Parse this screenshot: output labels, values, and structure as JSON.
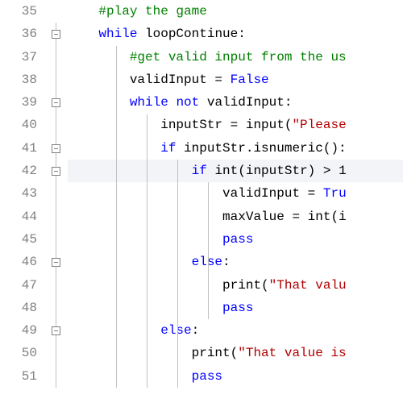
{
  "lines": [
    {
      "n": 35,
      "fold": false,
      "text": "    #play the game",
      "guides": [],
      "cls": "c-comment"
    },
    {
      "n": 36,
      "fold": true,
      "tokens": [
        [
          "    ",
          "c-plain"
        ],
        [
          "while",
          "c-kw"
        ],
        [
          " loopContinue:",
          "c-plain"
        ]
      ],
      "guides": []
    },
    {
      "n": 37,
      "fold": false,
      "tokens": [
        [
          "        ",
          "c-plain"
        ],
        [
          "#get valid input from the us",
          "c-comment"
        ]
      ],
      "guides": [
        1
      ]
    },
    {
      "n": 38,
      "fold": false,
      "tokens": [
        [
          "        validInput = ",
          "c-plain"
        ],
        [
          "False",
          "c-const"
        ]
      ],
      "guides": [
        1
      ]
    },
    {
      "n": 39,
      "fold": true,
      "tokens": [
        [
          "        ",
          "c-plain"
        ],
        [
          "while",
          "c-kw"
        ],
        [
          " ",
          "c-plain"
        ],
        [
          "not",
          "c-kw"
        ],
        [
          " validInput:",
          "c-plain"
        ]
      ],
      "guides": [
        1
      ]
    },
    {
      "n": 40,
      "fold": false,
      "tokens": [
        [
          "            inputStr = input(",
          "c-plain"
        ],
        [
          "\"Please",
          "c-str"
        ]
      ],
      "guides": [
        1,
        2
      ]
    },
    {
      "n": 41,
      "fold": true,
      "tokens": [
        [
          "            ",
          "c-plain"
        ],
        [
          "if",
          "c-kw"
        ],
        [
          " inputStr.isnumeric():",
          "c-plain"
        ]
      ],
      "guides": [
        1,
        2
      ]
    },
    {
      "n": 42,
      "fold": true,
      "hl": true,
      "tokens": [
        [
          "                ",
          "c-plain"
        ],
        [
          "if",
          "c-kw"
        ],
        [
          " ",
          "c-plain"
        ],
        [
          "int",
          "c-func"
        ],
        [
          "(inputStr) > 1",
          "c-plain"
        ]
      ],
      "guides": [
        1,
        2,
        3
      ]
    },
    {
      "n": 43,
      "fold": false,
      "tokens": [
        [
          "                    validInput = ",
          "c-plain"
        ],
        [
          "Tru",
          "c-const"
        ]
      ],
      "guides": [
        1,
        2,
        3,
        4
      ]
    },
    {
      "n": 44,
      "fold": false,
      "tokens": [
        [
          "                    maxValue = ",
          "c-plain"
        ],
        [
          "int",
          "c-func"
        ],
        [
          "(i",
          "c-plain"
        ]
      ],
      "guides": [
        1,
        2,
        3,
        4
      ]
    },
    {
      "n": 45,
      "fold": false,
      "tokens": [
        [
          "                    ",
          "c-plain"
        ],
        [
          "pass",
          "c-kw"
        ]
      ],
      "guides": [
        1,
        2,
        3,
        4
      ]
    },
    {
      "n": 46,
      "fold": true,
      "tokens": [
        [
          "                ",
          "c-plain"
        ],
        [
          "else",
          "c-kw"
        ],
        [
          ":",
          "c-plain"
        ]
      ],
      "guides": [
        1,
        2,
        3
      ]
    },
    {
      "n": 47,
      "fold": false,
      "tokens": [
        [
          "                    print(",
          "c-plain"
        ],
        [
          "\"That valu",
          "c-str"
        ]
      ],
      "guides": [
        1,
        2,
        3,
        4
      ]
    },
    {
      "n": 48,
      "fold": false,
      "tokens": [
        [
          "                    ",
          "c-plain"
        ],
        [
          "pass",
          "c-kw"
        ]
      ],
      "guides": [
        1,
        2,
        3,
        4
      ]
    },
    {
      "n": 49,
      "fold": true,
      "tokens": [
        [
          "            ",
          "c-plain"
        ],
        [
          "else",
          "c-kw"
        ],
        [
          ":",
          "c-plain"
        ]
      ],
      "guides": [
        1,
        2
      ]
    },
    {
      "n": 50,
      "fold": false,
      "tokens": [
        [
          "                print(",
          "c-plain"
        ],
        [
          "\"That value is",
          "c-str"
        ]
      ],
      "guides": [
        1,
        2,
        3
      ]
    },
    {
      "n": 51,
      "fold": false,
      "tokens": [
        [
          "                ",
          "c-plain"
        ],
        [
          "pass",
          "c-kw"
        ]
      ],
      "guides": [
        1,
        2,
        3
      ]
    }
  ],
  "indentUnit": 38,
  "rowHeight": 28.3
}
